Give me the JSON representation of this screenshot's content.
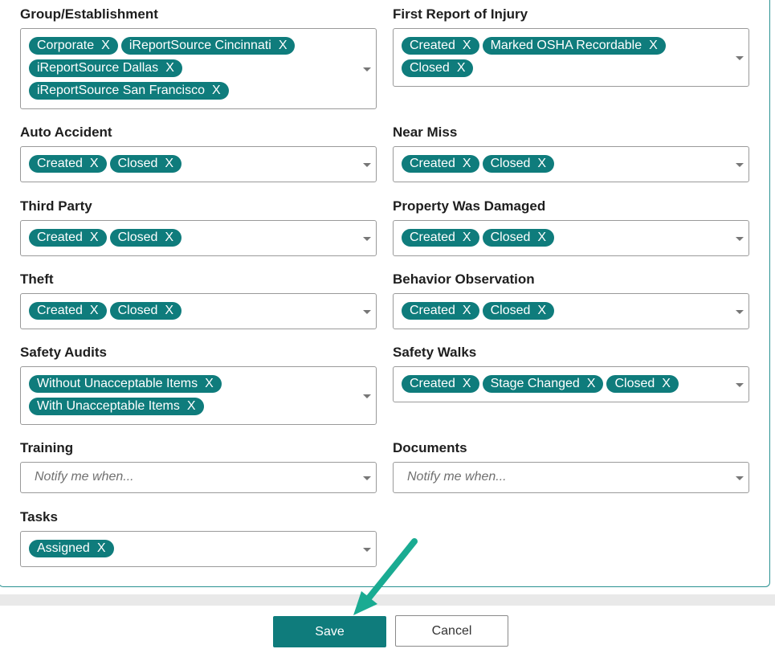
{
  "fields": [
    {
      "key": "group_establishment",
      "label": "Group/Establishment",
      "tags": [
        "Corporate",
        "iReportSource Cincinnati",
        "iReportSource Dallas",
        "iReportSource San Francisco"
      ]
    },
    {
      "key": "first_report_of_injury",
      "label": "First Report of Injury",
      "tags": [
        "Created",
        "Marked OSHA Recordable",
        "Closed"
      ]
    },
    {
      "key": "auto_accident",
      "label": "Auto Accident",
      "tags": [
        "Created",
        "Closed"
      ]
    },
    {
      "key": "near_miss",
      "label": "Near Miss",
      "tags": [
        "Created",
        "Closed"
      ]
    },
    {
      "key": "third_party",
      "label": "Third Party",
      "tags": [
        "Created",
        "Closed"
      ]
    },
    {
      "key": "property_was_damaged",
      "label": "Property Was Damaged",
      "tags": [
        "Created",
        "Closed"
      ]
    },
    {
      "key": "theft",
      "label": "Theft",
      "tags": [
        "Created",
        "Closed"
      ]
    },
    {
      "key": "behavior_observation",
      "label": "Behavior Observation",
      "tags": [
        "Created",
        "Closed"
      ]
    },
    {
      "key": "safety_audits",
      "label": "Safety Audits",
      "tags": [
        "Without Unacceptable Items",
        "With Unacceptable Items"
      ]
    },
    {
      "key": "safety_walks",
      "label": "Safety Walks",
      "tags": [
        "Created",
        "Stage Changed",
        "Closed"
      ]
    },
    {
      "key": "training",
      "label": "Training",
      "tags": [],
      "placeholder": "Notify me when..."
    },
    {
      "key": "documents",
      "label": "Documents",
      "tags": [],
      "placeholder": "Notify me when..."
    },
    {
      "key": "tasks",
      "label": "Tasks",
      "tags": [
        "Assigned"
      ]
    }
  ],
  "tag_remove_glyph": "X",
  "buttons": {
    "save": "Save",
    "cancel": "Cancel"
  },
  "colors": {
    "tag_bg": "#0f7c7c",
    "save_bg": "#0f7c7c",
    "arrow": "#1aab92"
  },
  "icons": {
    "dropdown": "chevron-down-icon",
    "annotation": "arrow-icon"
  }
}
